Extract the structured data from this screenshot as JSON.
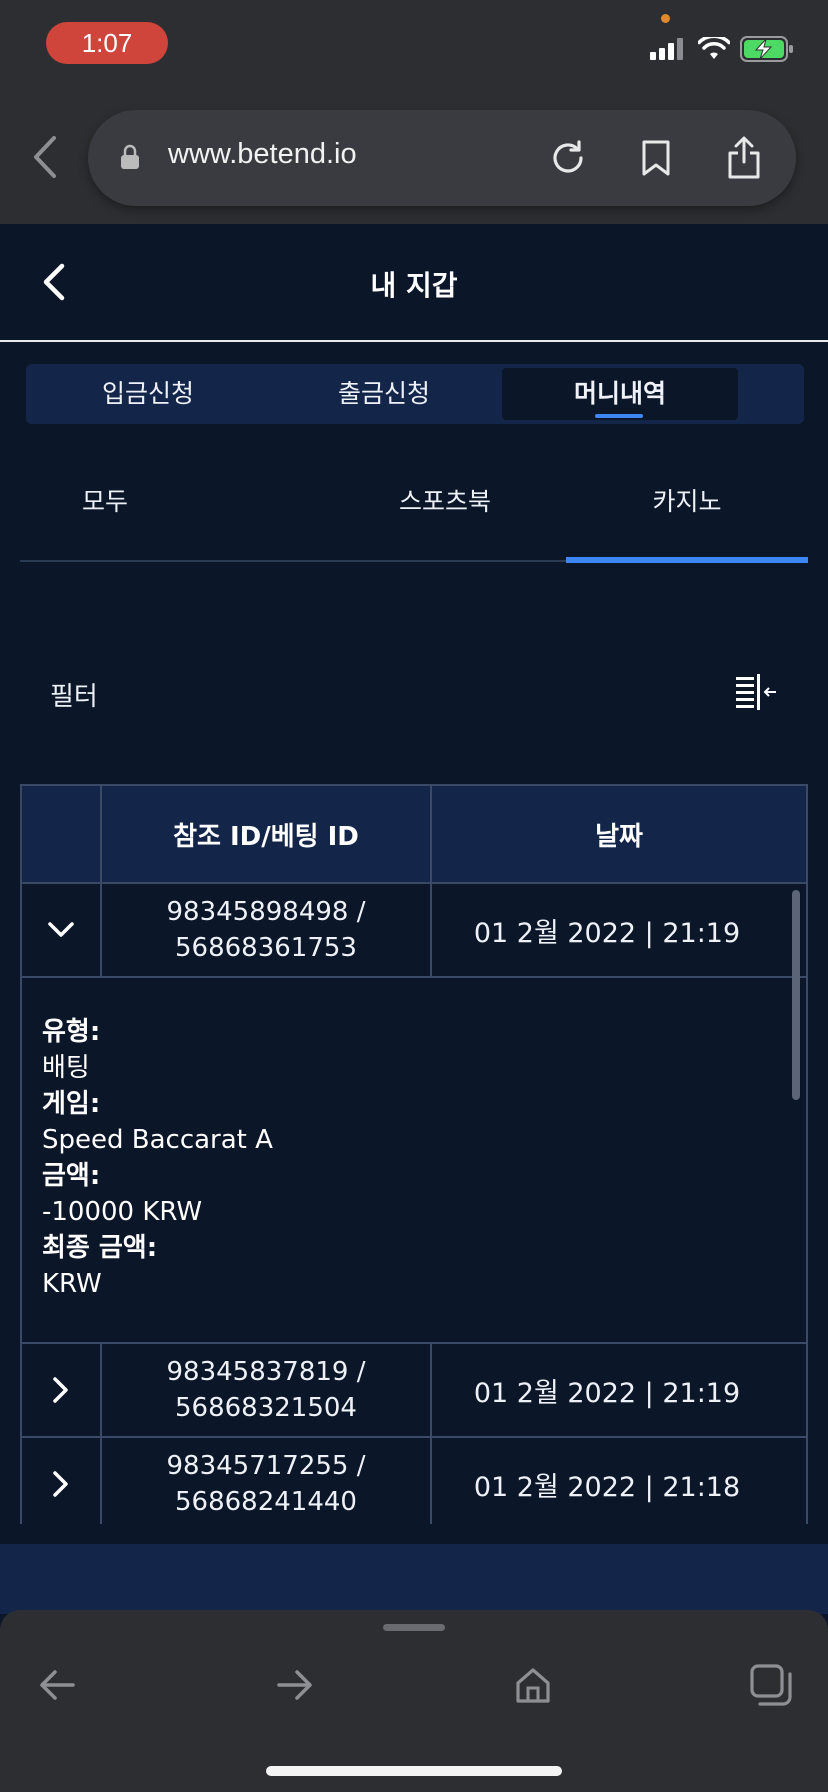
{
  "status_bar": {
    "time": "1:07"
  },
  "browser": {
    "url": "www.betend.io"
  },
  "header": {
    "title": "내 지갑"
  },
  "main_tabs": [
    {
      "label": "입금신청",
      "active": false
    },
    {
      "label": "출금신청",
      "active": false
    },
    {
      "label": "머니내역",
      "active": true
    }
  ],
  "sub_tabs": [
    {
      "label": "모두",
      "active": false
    },
    {
      "label": "스포츠북",
      "active": false
    },
    {
      "label": "카지노",
      "active": true
    }
  ],
  "filter": {
    "label": "필터"
  },
  "table": {
    "columns": [
      "",
      "참조 ID/베팅 ID",
      "날짜"
    ],
    "rows": [
      {
        "ref_id": "98345898498 /",
        "bet_id": "56868361753",
        "date": "01 2월 2022 | 21:19",
        "expanded": true
      },
      {
        "ref_id": "98345837819 /",
        "bet_id": "56868321504",
        "date": "01 2월 2022 | 21:19",
        "expanded": false
      },
      {
        "ref_id": "98345717255 /",
        "bet_id": "56868241440",
        "date": "01 2월 2022 | 21:18",
        "expanded": false
      }
    ],
    "detail": {
      "type_label": "유형:",
      "type_value": "배팅",
      "game_label": "게임:",
      "game_value": "Speed Baccarat A",
      "amount_label": "금액:",
      "amount_value": "-10000 KRW",
      "final_label": "최종 금액:",
      "final_value": "KRW"
    }
  },
  "colors": {
    "background": "#0b1629",
    "panel": "#13264a",
    "accent": "#3d87f5",
    "browser_chrome": "#2d2e32",
    "time_pill": "#d0453b"
  }
}
